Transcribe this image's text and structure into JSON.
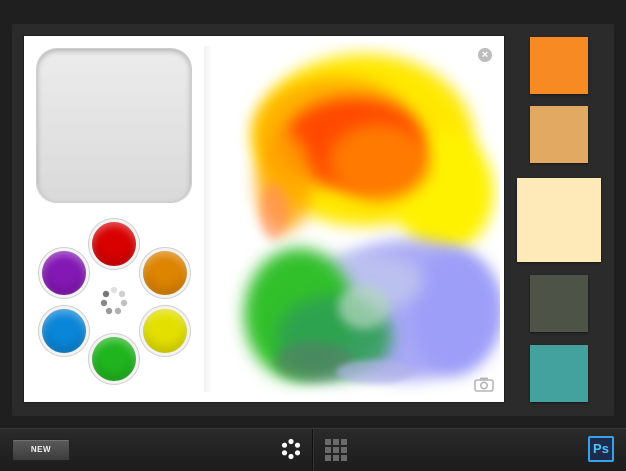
{
  "canvas": {
    "close_icon": "close-icon",
    "camera_icon": "camera-icon",
    "close_glyph": "×"
  },
  "palette": {
    "preview_color": "#e3e3e3",
    "paints": [
      {
        "name": "red",
        "color": "#d90000"
      },
      {
        "name": "orange",
        "color": "#dd8400"
      },
      {
        "name": "yellow",
        "color": "#e3e000"
      },
      {
        "name": "green",
        "color": "#20b51e"
      },
      {
        "name": "blue",
        "color": "#0a86d8"
      },
      {
        "name": "purple",
        "color": "#8418b4"
      }
    ]
  },
  "swatches": [
    {
      "color": "#f78a22"
    },
    {
      "color": "#e1a962"
    },
    {
      "color": "#fdeab8"
    },
    {
      "color": "#4d5346"
    },
    {
      "color": "#43a29d"
    }
  ],
  "toolbar": {
    "new_label": "NEW",
    "mix_icon": "color-wheel-icon",
    "grid_icon": "grid-icon",
    "ps_label": "Ps"
  }
}
